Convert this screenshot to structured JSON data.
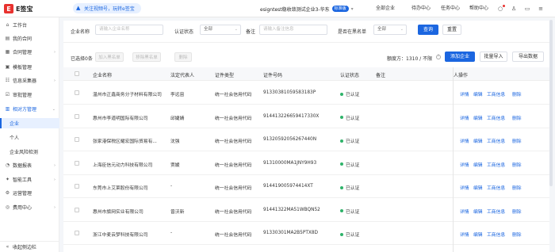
{
  "app": {
    "logo_mark": "E",
    "logo_text": "E签宝"
  },
  "promo": {
    "text": "关注视频号，玩转e签宝"
  },
  "header": {
    "company": "esigntest稳收敛测试企业3-华东",
    "version_badge": "标准版",
    "nav": [
      "全部企业",
      "待办中心",
      "任务中心",
      "帮助中心"
    ]
  },
  "sidebar": {
    "items": [
      {
        "icon": "home-icon",
        "label": "工作台"
      },
      {
        "icon": "doc-icon",
        "label": "我的合同"
      },
      {
        "icon": "contract-icon",
        "label": "合同管理"
      },
      {
        "icon": "template-icon",
        "label": "模板管理"
      },
      {
        "icon": "form-icon",
        "label": "信息采集器"
      },
      {
        "icon": "approval-icon",
        "label": "审批管理"
      },
      {
        "icon": "building-icon",
        "label": "相对方管理"
      },
      {
        "label": "企业"
      },
      {
        "label": "个人"
      },
      {
        "label": "企业风险检测"
      },
      {
        "icon": "chart-icon",
        "label": "数据报表"
      },
      {
        "icon": "tool-icon",
        "label": "智能工具"
      },
      {
        "icon": "settings-icon",
        "label": "运营管理"
      },
      {
        "icon": "money-icon",
        "label": "费用中心"
      }
    ],
    "collapse_label": "收起侧边栏"
  },
  "filters": {
    "name_label": "企业名称",
    "name_placeholder": "请输入企业名称",
    "auth_label": "认证状态",
    "auth_value": "全部",
    "remark_label": "备注",
    "remark_placeholder": "请输入备注信息",
    "blacklist_label": "是否在黑名单",
    "blacklist_value": "全部",
    "search_btn": "查询",
    "reset_btn": "重置"
  },
  "toolbar": {
    "selected": "已选择0条",
    "add_blacklist": "加入黑名单",
    "remove_blacklist": "移除黑名单",
    "delete": "删除",
    "quota": "额度方：1310 / 不限",
    "add_btn": "添加企业",
    "import_btn": "批量导入",
    "export_btn": "导出数据"
  },
  "table": {
    "columns": [
      "企业名称",
      "法定代表人",
      "证件类型",
      "证件号码",
      "认证状态",
      "备注",
      "人",
      "操作"
    ],
    "actions": [
      "详情",
      "编辑",
      "工商信息",
      "删除"
    ],
    "rows": [
      {
        "name": "温州市正鑫商务分子材料有限公司",
        "rep": "李远宙",
        "type": "统一社会信用代码",
        "no": "91330381059583183P",
        "status": "已认证"
      },
      {
        "name": "惠州市李道明国际有限公司",
        "rep": "邱婕婧",
        "type": "统一社会信用代码",
        "no": "914413226659417330X",
        "status": "已认证"
      },
      {
        "name": "张家港保税区耀宏国际贸易有...",
        "rep": "沈强",
        "type": "统一社会信用代码",
        "no": "91320592056267440N",
        "status": "已认证"
      },
      {
        "name": "上海臣信元动力科技有限公司",
        "rep": "贾媛",
        "type": "统一社会信用代码",
        "no": "91310000MA1JNY9H93",
        "status": "已认证"
      },
      {
        "name": "东莞市上艾莱股份有限公司",
        "rep": "-",
        "type": "统一社会信用代码",
        "no": "914419005974414XT",
        "status": "已认证"
      },
      {
        "name": "惠州市旗网实业有限公司",
        "rep": "曾沃新",
        "type": "统一社会信用代码",
        "no": "91441322MA51WBQN52",
        "status": "已认证"
      },
      {
        "name": "浙江中麦云梦科技有限公司",
        "rep": "-",
        "type": "统一社会信用代码",
        "no": "91330301MA2B5PTX8D",
        "status": "已认证"
      }
    ]
  },
  "colors": {
    "primary": "#1b66e0",
    "brand": "#e8322f",
    "success": "#2fb36a"
  }
}
